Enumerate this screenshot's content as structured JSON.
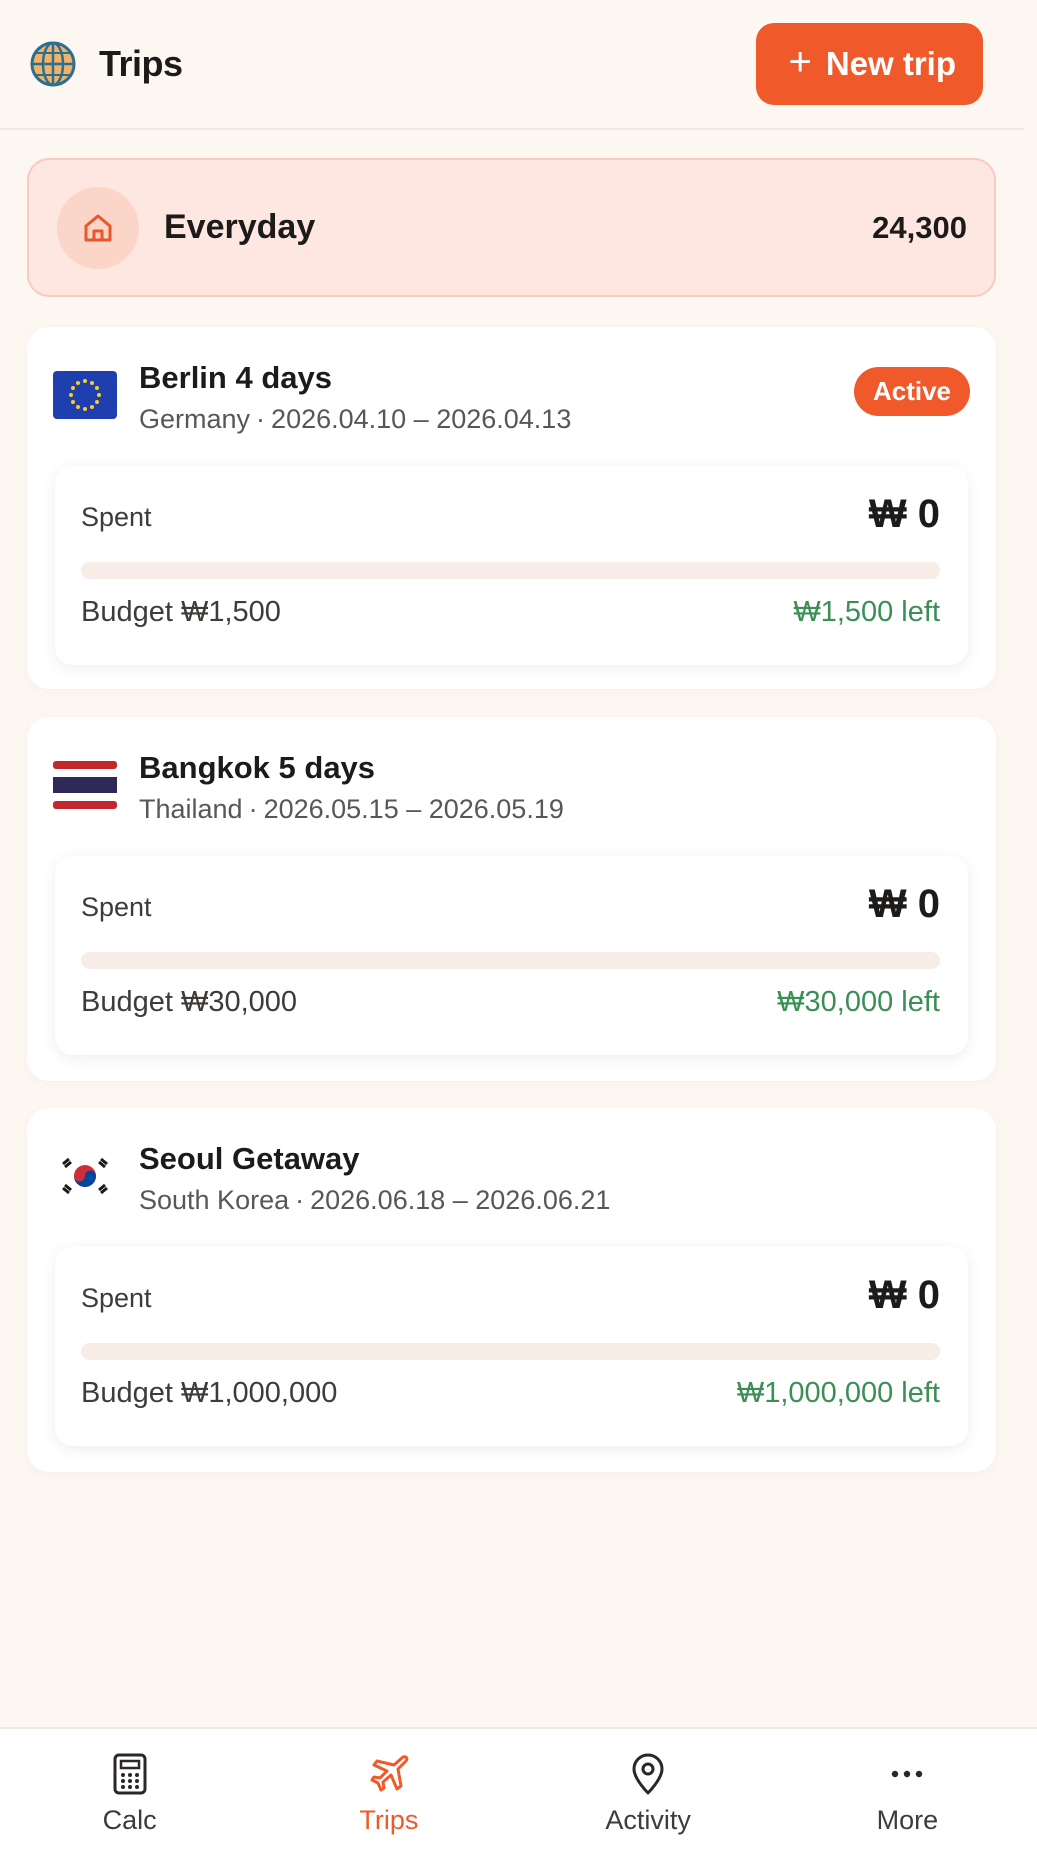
{
  "header": {
    "title": "Trips",
    "new_trip_label": "New trip"
  },
  "everyday": {
    "label": "Everyday",
    "amount": "24,300"
  },
  "trips": [
    {
      "name": "Berlin 4 days",
      "country": "Germany",
      "dates": "2026.04.10 – 2026.04.13",
      "flag": "eu-flag-icon",
      "badge": "Active",
      "spent_label": "Spent",
      "spent": "₩ 0",
      "progress": 0,
      "budget": "Budget ₩1,500",
      "left": "₩1,500 left"
    },
    {
      "name": "Bangkok 5 days",
      "country": "Thailand",
      "dates": "2026.05.15 – 2026.05.19",
      "flag": "thailand-flag-icon",
      "spent_label": "Spent",
      "spent": "₩ 0",
      "progress": 0,
      "budget": "Budget ₩30,000",
      "left": "₩30,000 left"
    },
    {
      "name": "Seoul Getaway",
      "country": "South Korea",
      "dates": "2026.06.18 – 2026.06.21",
      "flag": "korea-flag-icon",
      "spent_label": "Spent",
      "spent": "₩ 0",
      "progress": 0,
      "budget": "Budget ₩1,000,000",
      "left": "₩1,000,000 left"
    }
  ],
  "nav": {
    "items": [
      {
        "label": "Calc",
        "icon": "calculator-icon"
      },
      {
        "label": "Trips",
        "icon": "airplane-icon",
        "active": true
      },
      {
        "label": "Activity",
        "icon": "map-pin-icon"
      },
      {
        "label": "More",
        "icon": "more-dots-icon"
      }
    ]
  },
  "colors": {
    "accent": "#f05a2a",
    "positive": "#3a8f55",
    "background": "#fdf7f2"
  }
}
